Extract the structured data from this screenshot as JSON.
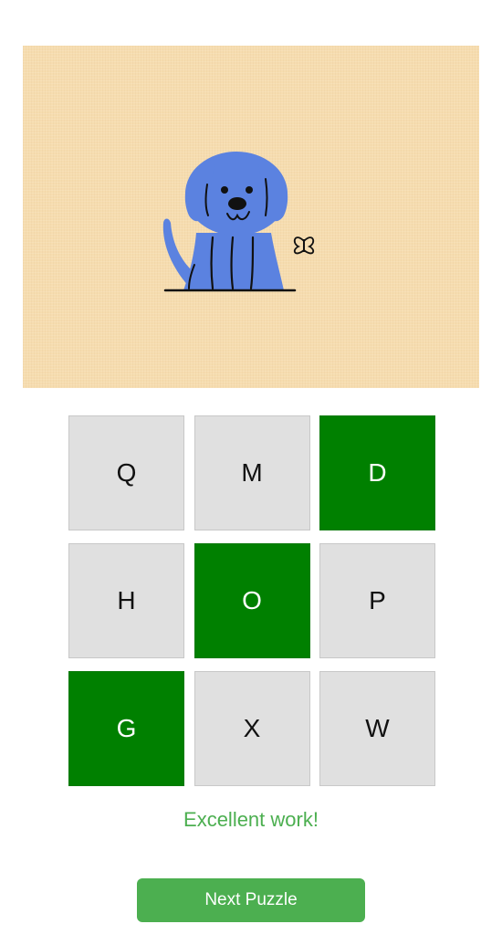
{
  "puzzle": {
    "image_subject": "blue-dog-illustration",
    "tiles": [
      {
        "letter": "Q",
        "selected": false
      },
      {
        "letter": "M",
        "selected": false
      },
      {
        "letter": "D",
        "selected": true
      },
      {
        "letter": "H",
        "selected": false
      },
      {
        "letter": "O",
        "selected": true
      },
      {
        "letter": "P",
        "selected": false
      },
      {
        "letter": "G",
        "selected": true
      },
      {
        "letter": "X",
        "selected": false
      },
      {
        "letter": "W",
        "selected": false
      }
    ]
  },
  "feedback": {
    "message": "Excellent work!"
  },
  "actions": {
    "next_label": "Next Puzzle"
  },
  "colors": {
    "tile_default": "#e0e0e0",
    "tile_selected": "#008000",
    "success": "#4caf50",
    "picture_bg": "#f6dcaf",
    "dog": "#5b82e0"
  }
}
